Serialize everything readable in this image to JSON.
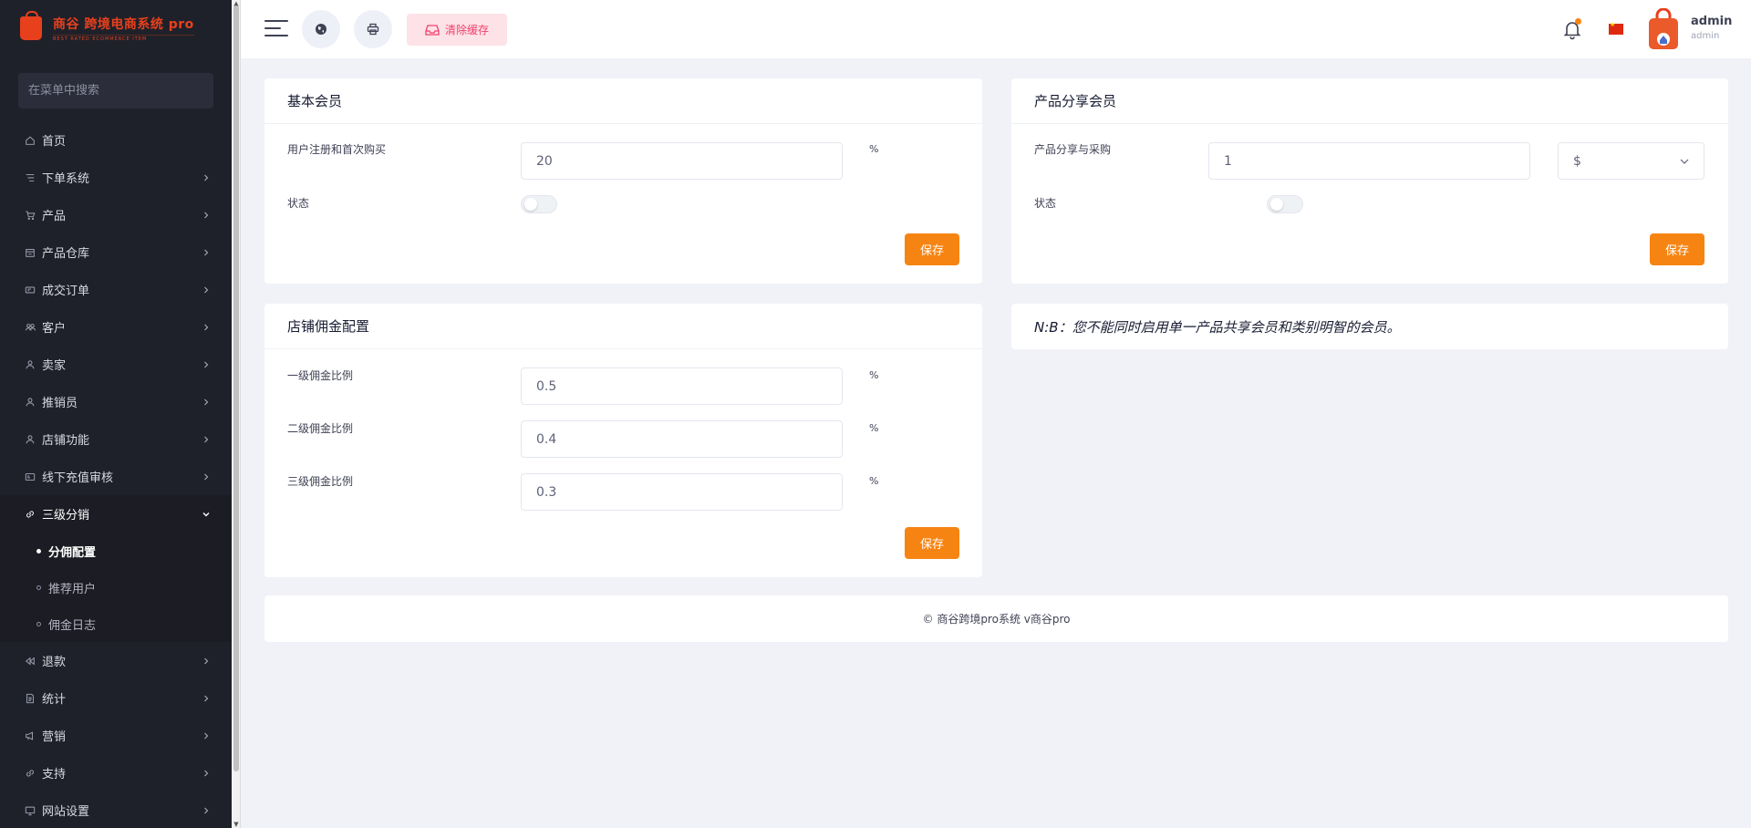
{
  "brand": {
    "title": "商谷 跨境电商系统 pro",
    "subtitle": "BEST RATED ECOMMERCE ITEM"
  },
  "sidebar": {
    "search_placeholder": "在菜单中搜索",
    "items": [
      {
        "label": "首页",
        "icon": "home-icon",
        "has_children": false
      },
      {
        "label": "下单系统",
        "icon": "list-icon",
        "has_children": true
      },
      {
        "label": "产品",
        "icon": "cart-icon",
        "has_children": true
      },
      {
        "label": "产品仓库",
        "icon": "warehouse-icon",
        "has_children": true
      },
      {
        "label": "成交订单",
        "icon": "ticket-icon",
        "has_children": true
      },
      {
        "label": "客户",
        "icon": "users-icon",
        "has_children": true
      },
      {
        "label": "卖家",
        "icon": "user-icon",
        "has_children": true
      },
      {
        "label": "推销员",
        "icon": "user-icon",
        "has_children": true
      },
      {
        "label": "店铺功能",
        "icon": "user-icon",
        "has_children": true
      },
      {
        "label": "线下充值审核",
        "icon": "card-icon",
        "has_children": true
      },
      {
        "label": "三级分销",
        "icon": "link-icon",
        "has_children": true,
        "open": true,
        "children": [
          {
            "label": "分佣配置",
            "active": true
          },
          {
            "label": "推荐用户",
            "active": false
          },
          {
            "label": "佣金日志",
            "active": false
          }
        ]
      },
      {
        "label": "退款",
        "icon": "refund-icon",
        "has_children": true
      },
      {
        "label": "统计",
        "icon": "document-icon",
        "has_children": true
      },
      {
        "label": "营销",
        "icon": "megaphone-icon",
        "has_children": true
      },
      {
        "label": "支持",
        "icon": "link-icon",
        "has_children": true
      },
      {
        "label": "网站设置",
        "icon": "monitor-icon",
        "has_children": true
      }
    ]
  },
  "header": {
    "clear_cache_label": "清除缓存",
    "user_name": "admin",
    "user_role": "admin",
    "accent": "#f68413"
  },
  "basic_member": {
    "title": "基本会员",
    "field_label": "用户注册和首次购买",
    "field_value": "20",
    "unit": "%",
    "status_label": "状态",
    "status_on": false,
    "save_label": "保存"
  },
  "product_share": {
    "title": "产品分享会员",
    "field_label": "产品分享与采购",
    "field_value": "1",
    "currency": "$",
    "status_label": "状态",
    "status_on": false,
    "save_label": "保存"
  },
  "shop_commission": {
    "title": "店铺佣金配置",
    "rows": [
      {
        "label": "一级佣金比例",
        "value": "0.5",
        "unit": "%"
      },
      {
        "label": "二级佣金比例",
        "value": "0.4",
        "unit": "%"
      },
      {
        "label": "三级佣金比例",
        "value": "0.3",
        "unit": "%"
      }
    ],
    "save_label": "保存"
  },
  "notice": "N:B：您不能同时启用单一产品共享会员和类别明智的会员。",
  "footer": "© 商谷跨境pro系统 v商谷pro"
}
